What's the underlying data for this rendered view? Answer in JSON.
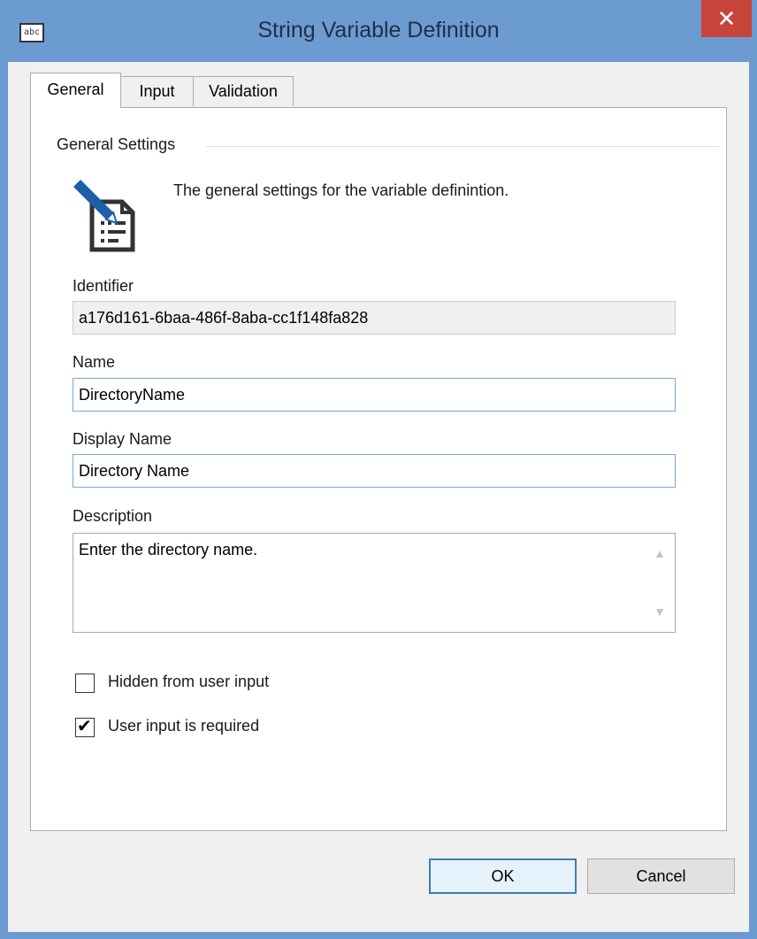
{
  "window": {
    "title": "String Variable Definition",
    "app_icon_text": "abc",
    "close_label": "✕"
  },
  "tabs": [
    {
      "label": "General",
      "active": true
    },
    {
      "label": "Input",
      "active": false
    },
    {
      "label": "Validation",
      "active": false
    }
  ],
  "general": {
    "group_title": "General Settings",
    "description": "The general settings for the variable definintion.",
    "icon": "edit-document-icon",
    "identifier": {
      "label": "Identifier",
      "value": "a176d161-6baa-486f-8aba-cc1f148fa828"
    },
    "name": {
      "label": "Name",
      "value": "DirectoryName"
    },
    "display_name": {
      "label": "Display Name",
      "value": "Directory Name"
    },
    "description_field": {
      "label": "Description",
      "value": "Enter the directory name."
    },
    "hidden_checkbox": {
      "label": "Hidden from user input",
      "checked": false
    },
    "required_checkbox": {
      "label": "User input is required",
      "checked": true
    }
  },
  "buttons": {
    "ok": "OK",
    "cancel": "Cancel"
  },
  "colors": {
    "titlebar": "#6b9bd1",
    "close": "#c7443a",
    "icon_blue": "#1d5fa8"
  }
}
